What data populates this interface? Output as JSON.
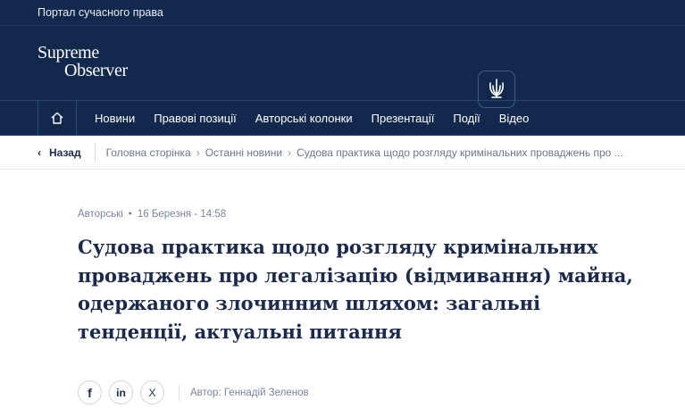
{
  "topbar": {
    "tagline": "Портал сучасного права"
  },
  "header": {
    "logo_line1": "Supreme",
    "logo_line2": "Observer",
    "emblem": "trident-icon"
  },
  "nav": {
    "items": [
      {
        "label": "Новини"
      },
      {
        "label": "Правові позиції"
      },
      {
        "label": "Авторські колонки"
      },
      {
        "label": "Презентації"
      },
      {
        "label": "Події"
      },
      {
        "label": "Відео"
      }
    ]
  },
  "breadcrumb": {
    "back": "Назад",
    "items": [
      "Головна сторінка",
      "Останні новини",
      "Судова практика щодо розгляду кримінальних проваджень про ..."
    ]
  },
  "article": {
    "category": "Авторські",
    "date": "16 Березня - 14:58",
    "title": "Судова практика щодо розгляду кримінальних проваджень про легалізацію (відмивання) майна, одержаного злочинним шляхом: загальні тенденції, актуальні питання",
    "author": "Автор: Геннадій Зеленов",
    "share": [
      "f",
      "in",
      "X"
    ]
  },
  "colors": {
    "brand": "#12284c",
    "text": "#1b2a4a",
    "muted": "#7a8496"
  }
}
